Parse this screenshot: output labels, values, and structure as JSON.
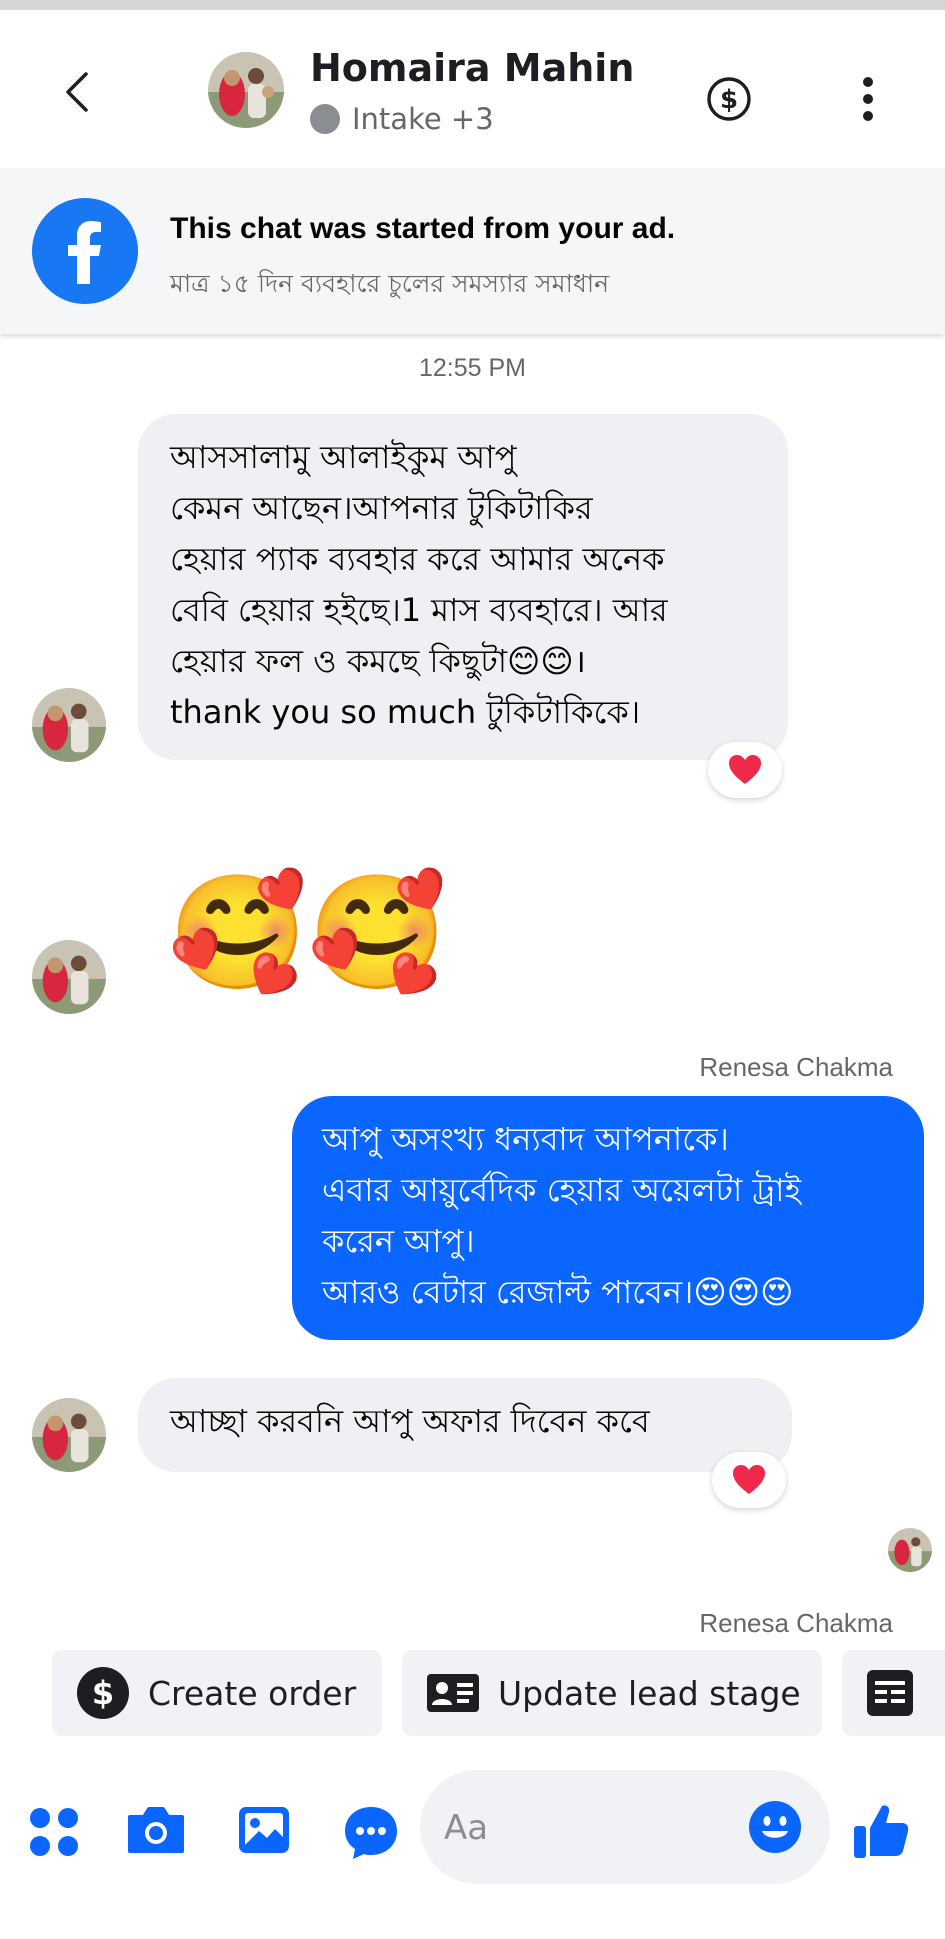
{
  "header": {
    "contact_name": "Homaira Mahin",
    "status_label": "Intake +3"
  },
  "ad_banner": {
    "title": "This chat was started from your ad.",
    "subtitle": "মাত্র ১৫ দিন ব্যবহারে চুলের সমস্যার সমাধান"
  },
  "thread": {
    "timestamp": "12:55 PM",
    "messages": [
      {
        "direction": "incoming",
        "lines": [
          "আসসালামু আলাইকুম  আপু",
          "কেমন আছেন।আপনার টুকিটাকির",
          "হেয়ার প্যাক ব্যবহার করে আমার অনেক",
          "বেবি হেয়ার হইছে।1 মাস ব্যবহারে। আর",
          "হেয়ার ফল ও কমছে  কিছুটা😊😊।",
          "thank you so much টুকিটাকিকে।"
        ],
        "reaction": "❤️"
      },
      {
        "direction": "incoming",
        "emoji": "🥰🥰"
      },
      {
        "direction": "outgoing",
        "sender": "Renesa Chakma",
        "lines": [
          "আপু অসংখ্য ধন্যবাদ আপনাকে।",
          "এবার আয়ুর্বেদিক হেয়ার অয়েলটা ট্রাই",
          "করেন আপু।",
          "আরও বেটার রেজাল্ট পাবেন।😍😍😍"
        ]
      },
      {
        "direction": "incoming",
        "lines": [
          "আচ্ছা করবনি আপু  অফার  দিবেন কবে"
        ],
        "reaction": "❤️"
      }
    ],
    "last_sender": "Renesa Chakma"
  },
  "actions": {
    "create_order": "Create order",
    "update_lead_stage": "Update lead stage"
  },
  "composer": {
    "placeholder": "Aa"
  },
  "colors": {
    "accent": "#0a66ff",
    "facebook_blue": "#1877f2",
    "incoming_bubble": "#eff0f3",
    "reaction_heart": "#f02849"
  },
  "icons": [
    "chevron-left-icon",
    "dollar-circle-icon",
    "more-vertical-icon",
    "facebook-logo-icon",
    "dollar-icon",
    "id-card-icon",
    "form-icon",
    "apps-icon",
    "camera-icon",
    "photo-icon",
    "chat-bubble-icon",
    "smiley-icon",
    "thumbs-up-icon",
    "heart-icon"
  ]
}
